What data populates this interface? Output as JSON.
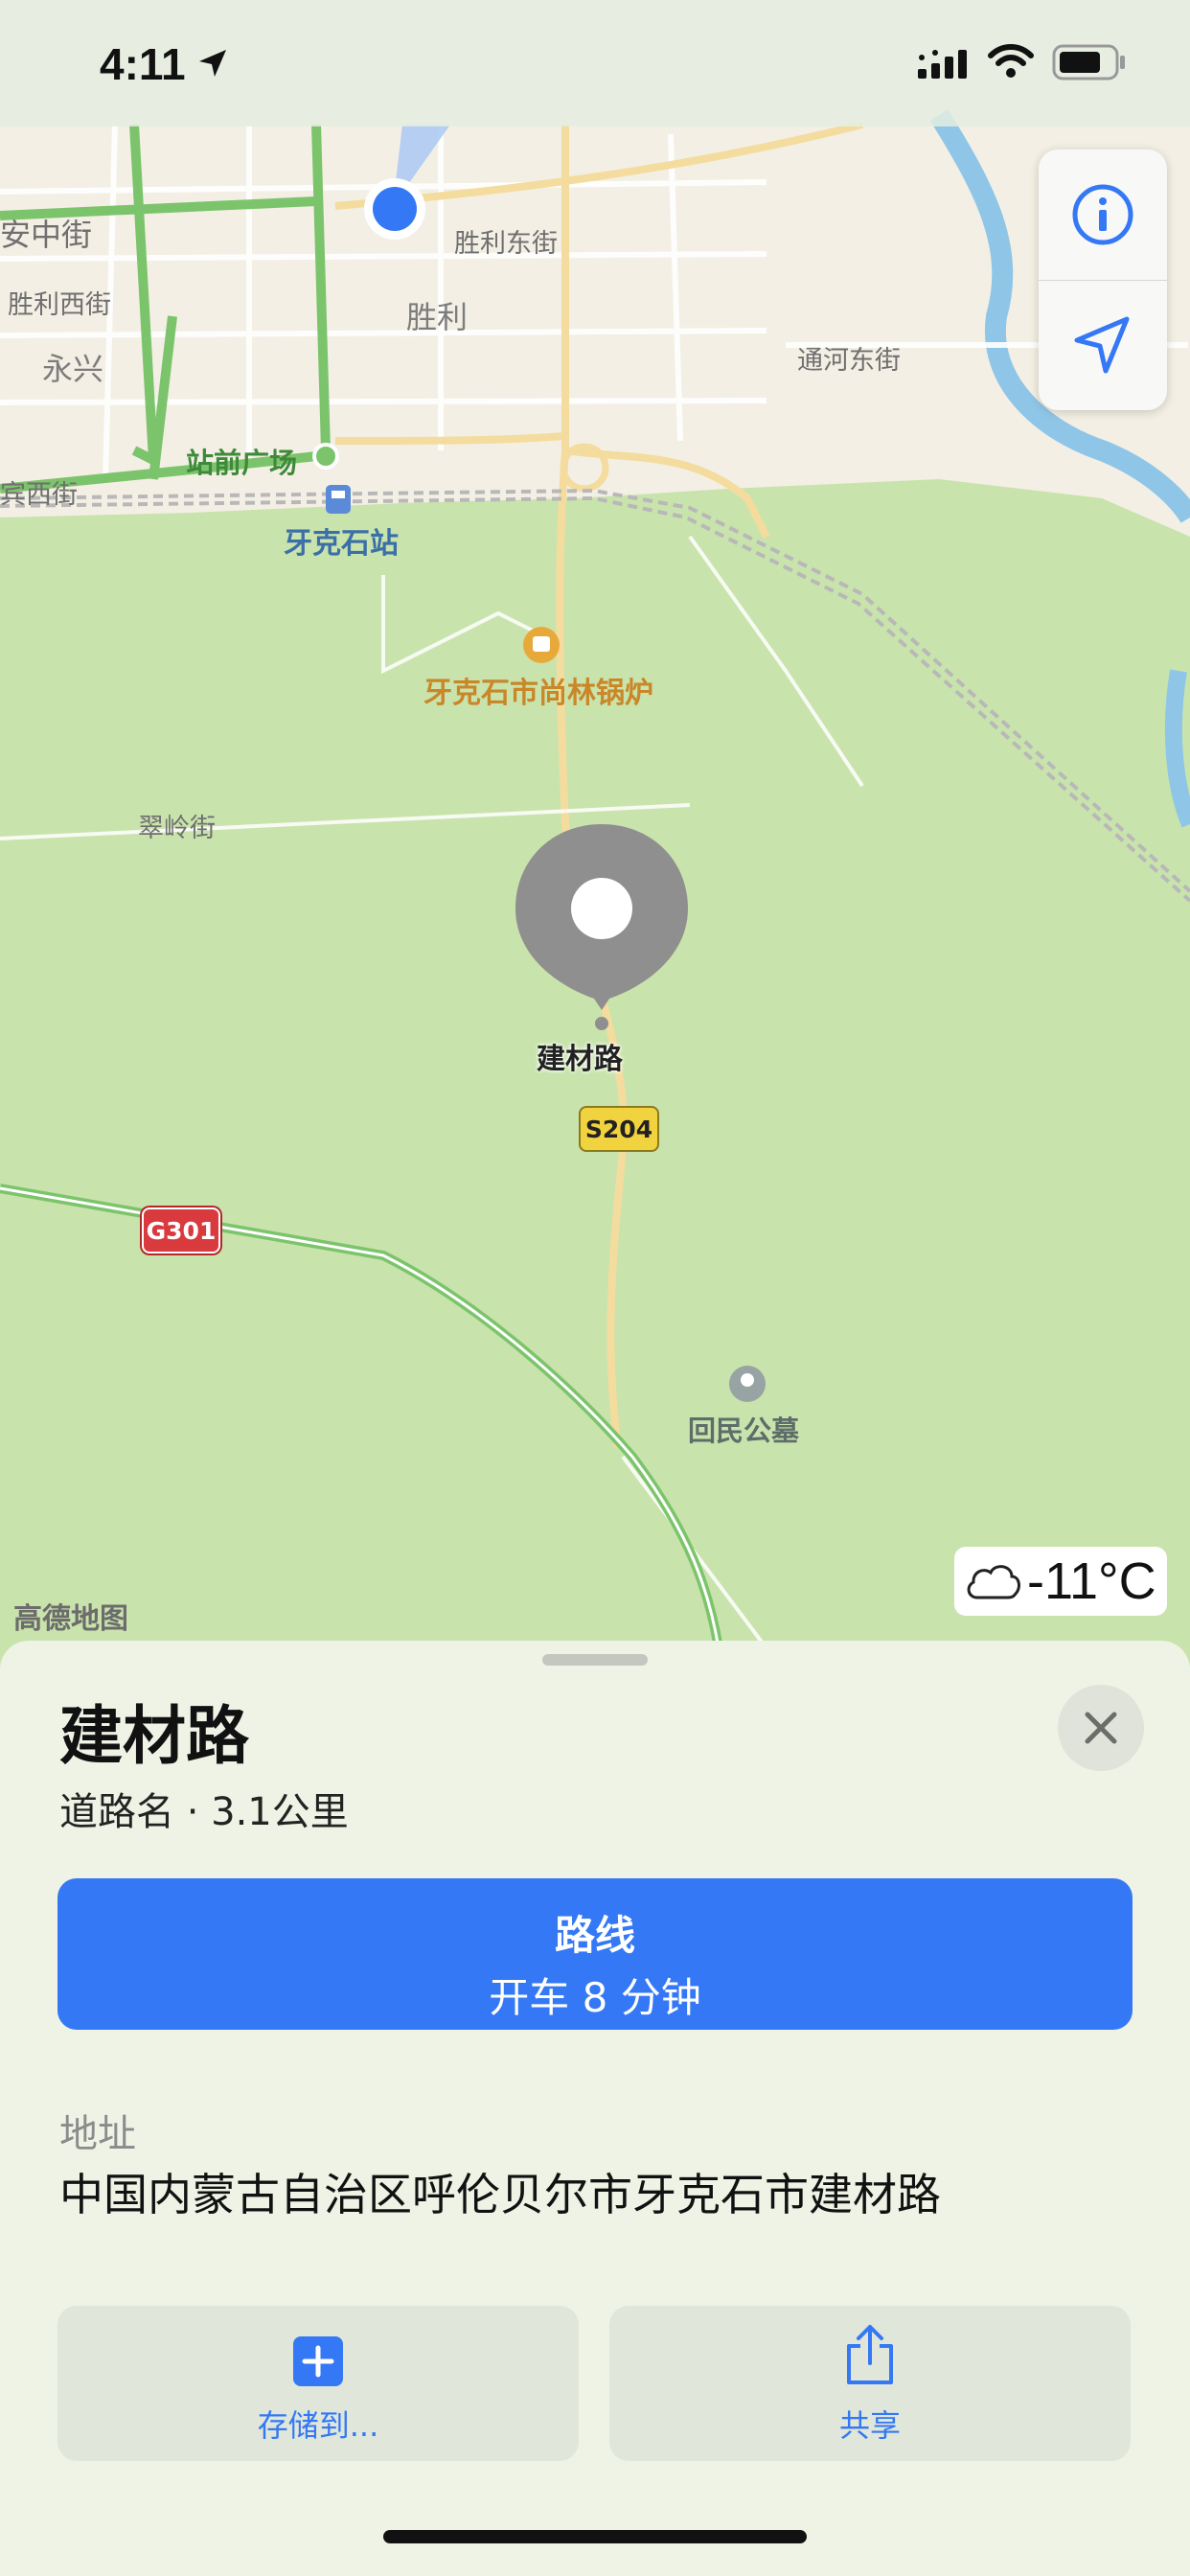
{
  "status_bar": {
    "time": "4:11"
  },
  "map": {
    "attribution": "高德地图",
    "weather": {
      "temperature": "-11°C",
      "icon": "cloud-icon"
    },
    "labels": {
      "anzhong_st": "安中街",
      "shengli_west_st": "胜利西街",
      "yongxing": "永兴",
      "bin_west_st": "宾西街",
      "shengli_east_st": "胜利东街",
      "shengli": "胜利",
      "tonghe_east_st": "通河东街",
      "station_square": "站前广场",
      "yakeshi_station": "牙克石站",
      "boiler_poi": "牙克石市尚林锅炉",
      "cuiling_st": "翠岭街",
      "pin_label": "建材路",
      "cemetery": "回民公墓"
    },
    "shields": {
      "s204": "S204",
      "g301": "G301"
    }
  },
  "sheet": {
    "title": "建材路",
    "subtitle": "道路名 · 3.1公里",
    "route": {
      "label": "路线",
      "detail": "开车 8 分钟"
    },
    "address": {
      "heading": "地址",
      "value": "中国内蒙古自治区呼伦贝尔市牙克石市建材路"
    },
    "actions": {
      "save": "存储到...",
      "share": "共享"
    }
  },
  "colors": {
    "accent": "#3478f6",
    "park_green": "#c9e3ac",
    "urban": "#f3efe4"
  }
}
